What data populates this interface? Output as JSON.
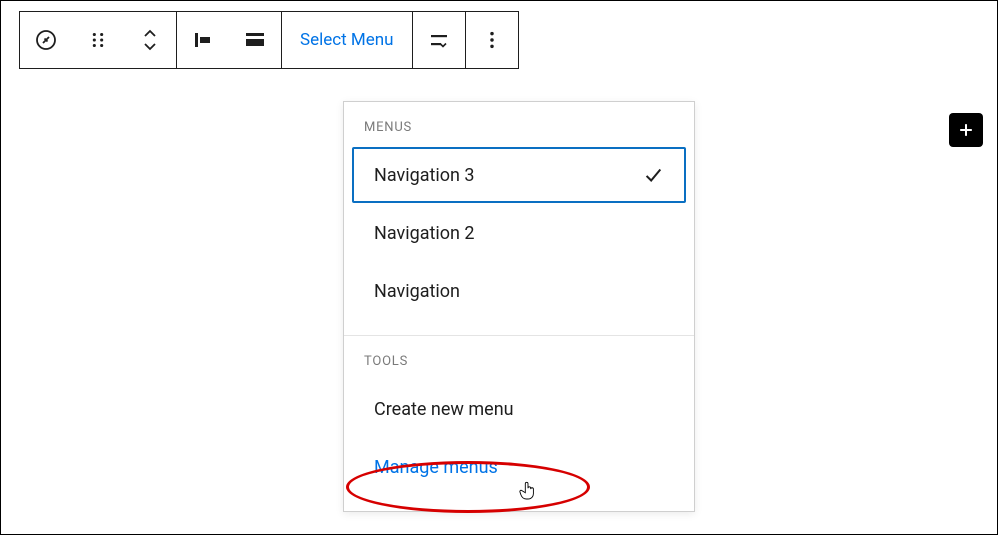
{
  "toolbar": {
    "select_menu_label": "Select Menu"
  },
  "dropdown": {
    "section_menus_title": "MENUS",
    "section_tools_title": "TOOLS",
    "menu_items": [
      {
        "label": "Navigation 3",
        "selected": true
      },
      {
        "label": "Navigation 2",
        "selected": false
      },
      {
        "label": "Navigation",
        "selected": false
      }
    ],
    "tool_items": [
      {
        "label": "Create new menu"
      },
      {
        "label": "Manage menus"
      }
    ]
  }
}
